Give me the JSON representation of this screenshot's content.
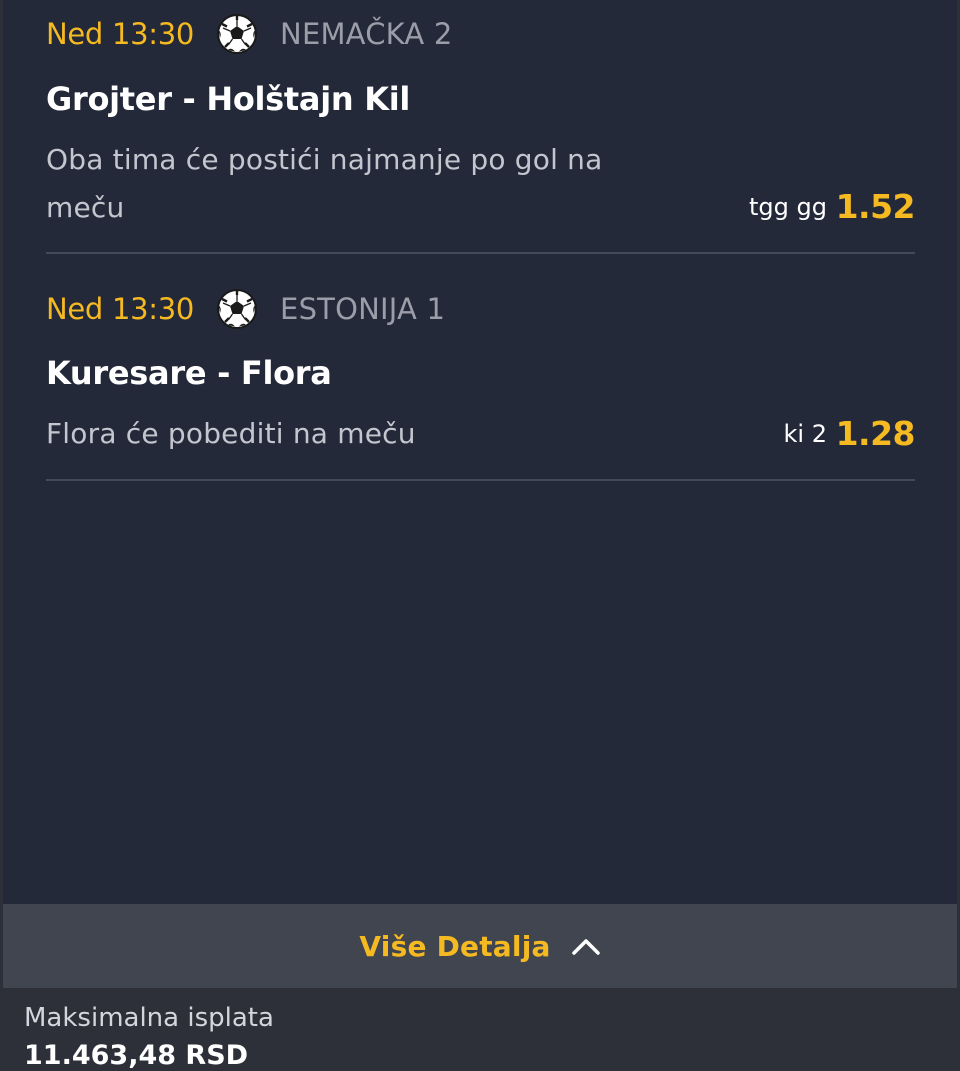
{
  "events": [
    {
      "time": "Ned 13:30",
      "sport_icon": "soccer-ball-icon",
      "league": "NEMAČKA 2",
      "match": "Grojter - Holštajn Kil",
      "market": "Oba tima će postići najmanje po gol na meču",
      "pick": "tgg gg",
      "odd": "1.52"
    },
    {
      "time": "Ned 13:30",
      "sport_icon": "soccer-ball-icon",
      "league": "ESTONIJA 1",
      "match": "Kuresare - Flora",
      "market": "Flora će pobediti na meču",
      "pick": "ki 2",
      "odd": "1.28"
    }
  ],
  "details": {
    "label": "Više Detalja",
    "icon": "chevron-up-icon"
  },
  "payout": {
    "label": "Maksimalna isplata",
    "value": "11.463,48 RSD"
  },
  "colors": {
    "accent": "#f5b921",
    "card_background": "#232938",
    "page_background": "#2e3039",
    "details_bar_background": "#41454f",
    "divider": "#454a59"
  }
}
